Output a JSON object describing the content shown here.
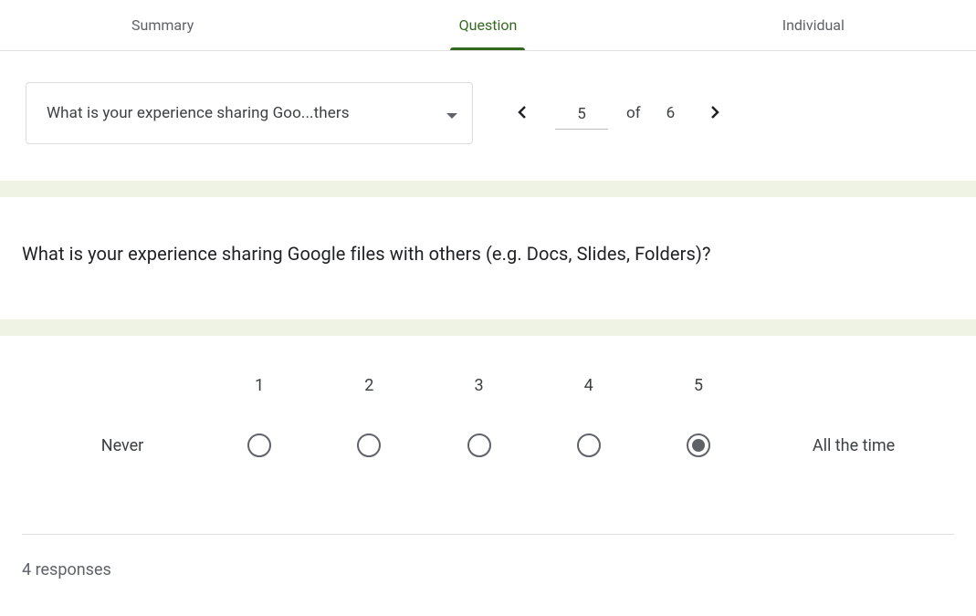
{
  "tabs": {
    "summary": "Summary",
    "question": "Question",
    "individual": "Individual",
    "active": "question"
  },
  "selector": {
    "label": "What is your experience sharing Goo...thers"
  },
  "pager": {
    "current": "5",
    "of_label": "of",
    "total": "6"
  },
  "question": {
    "text": "What is your experience sharing Google files with others (e.g. Docs, Slides, Folders)?"
  },
  "scale": {
    "left_label": "Never",
    "right_label": "All the time",
    "options": [
      "1",
      "2",
      "3",
      "4",
      "5"
    ],
    "selected_index": 4
  },
  "responses": {
    "text": "4 responses"
  }
}
